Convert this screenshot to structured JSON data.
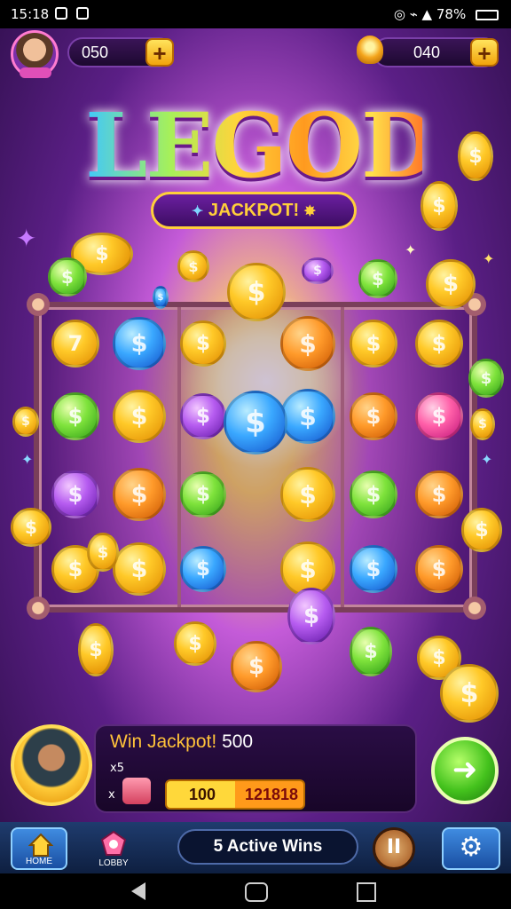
{
  "status_bar": {
    "time": "15:18",
    "battery": "78%"
  },
  "top_bar": {
    "avatar_tag": "",
    "coins_value": "050",
    "gems_value": "040",
    "plus_label": "+"
  },
  "logo": {
    "title": "LEGOD",
    "subtitle": "JACKPOT!"
  },
  "board": {
    "coins": [
      {
        "color": "gold",
        "symbol": "7"
      },
      {
        "color": "blue",
        "symbol": "$"
      },
      {
        "color": "gold",
        "symbol": "$"
      },
      {
        "color": "orange",
        "symbol": "$"
      },
      {
        "color": "gold",
        "symbol": "$"
      },
      {
        "color": "gold",
        "symbol": "$"
      },
      {
        "color": "green",
        "symbol": "$"
      },
      {
        "color": "gold",
        "symbol": "$"
      },
      {
        "color": "purple",
        "symbol": "$"
      },
      {
        "color": "blue",
        "symbol": "$"
      },
      {
        "color": "orange",
        "symbol": "$"
      },
      {
        "color": "pink",
        "symbol": "$"
      },
      {
        "color": "purple",
        "symbol": "$"
      },
      {
        "color": "orange",
        "symbol": "$"
      },
      {
        "color": "green",
        "symbol": "$"
      },
      {
        "color": "gold",
        "symbol": "$"
      },
      {
        "color": "green",
        "symbol": "$"
      },
      {
        "color": "orange",
        "symbol": "$"
      },
      {
        "color": "gold",
        "symbol": "$"
      },
      {
        "color": "gold",
        "symbol": "$"
      },
      {
        "color": "blue",
        "symbol": "$"
      },
      {
        "color": "gold",
        "symbol": "$"
      },
      {
        "color": "blue",
        "symbol": "$"
      },
      {
        "color": "orange",
        "symbol": "$"
      }
    ]
  },
  "win_panel": {
    "title_a": "Win Jackpot!",
    "title_b": "500",
    "multiplier": "x5",
    "small_x": "x",
    "amount_left": "100",
    "amount_right": "121818"
  },
  "play_button": {
    "label": "➜"
  },
  "bottom_bar": {
    "home_label": "HOME",
    "shop_label": "LOBBY",
    "info_text": "5 Active Wins",
    "pause_label": "II",
    "settings_icon": "⚙"
  },
  "colors": {
    "accent": "#ffc23a",
    "bg": "#5b1f86",
    "button_green": "#44c21d"
  }
}
